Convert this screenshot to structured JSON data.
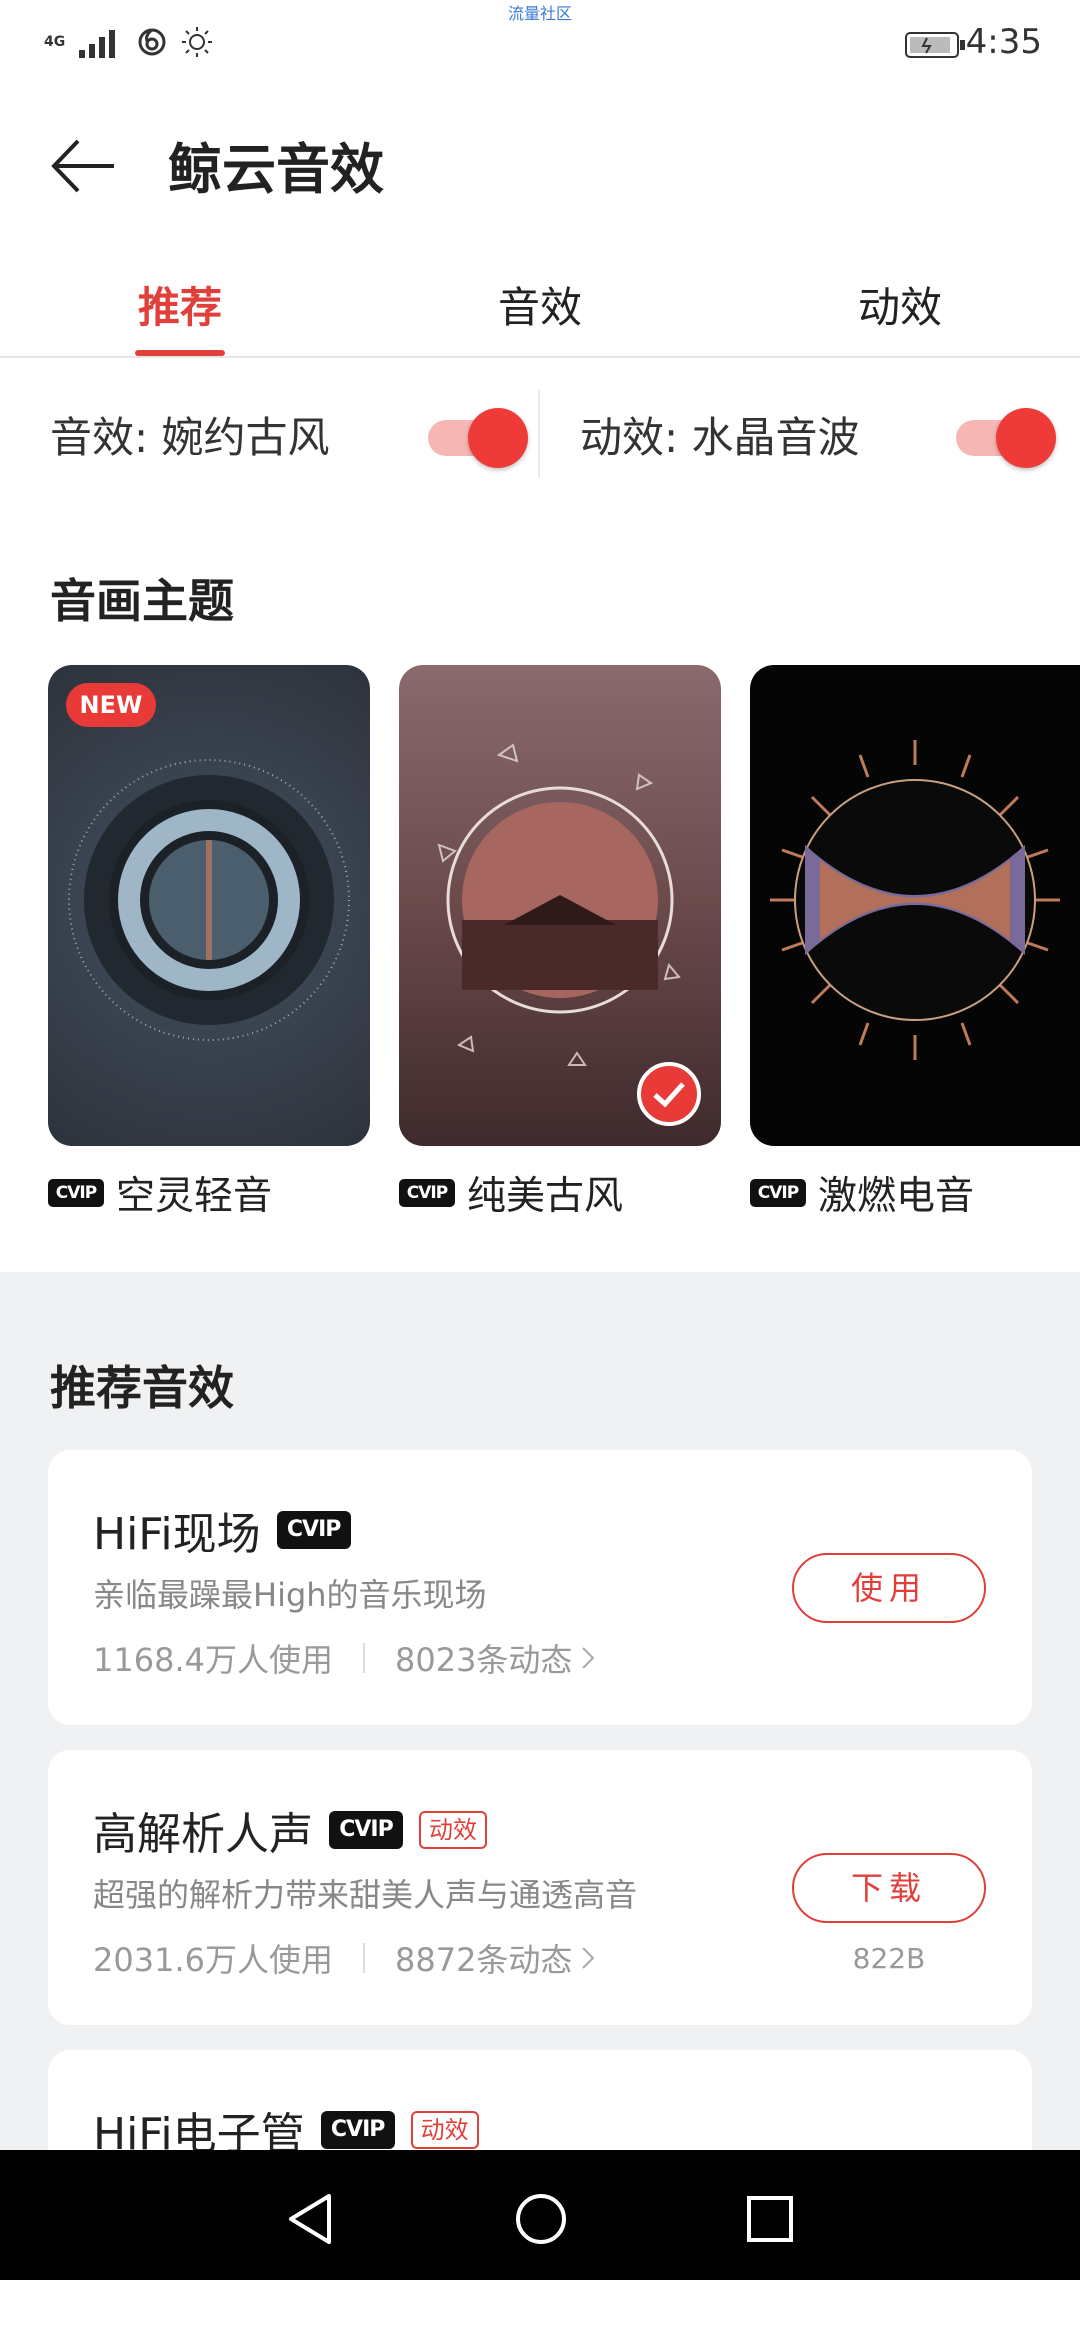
{
  "status_bar": {
    "carrier_text": "流量社区",
    "network": "4G",
    "time": "4:35"
  },
  "header": {
    "title": "鲸云音效"
  },
  "tabs": [
    {
      "label": "推荐",
      "active": true
    },
    {
      "label": "音效",
      "active": false
    },
    {
      "label": "动效",
      "active": false
    }
  ],
  "toggles": {
    "sound": {
      "label": "音效: 婉约古风",
      "on": true
    },
    "motion": {
      "label": "动效: 水晶音波",
      "on": true
    }
  },
  "themes_section": {
    "title": "音画主题",
    "items": [
      {
        "name": "空灵轻音",
        "vip": "CVIP",
        "badge": "NEW",
        "selected": false
      },
      {
        "name": "纯美古风",
        "vip": "CVIP",
        "badge": "",
        "selected": true
      },
      {
        "name": "激燃电音",
        "vip": "CVIP",
        "badge": "",
        "selected": false
      }
    ]
  },
  "effects_section": {
    "title": "推荐音效",
    "items": [
      {
        "name": "HiFi现场",
        "vip": "CVIP",
        "tag": "",
        "desc": "亲临最躁最High的音乐现场",
        "users": "1168.4万人使用",
        "posts": "8023条动态",
        "action": "使用",
        "size": ""
      },
      {
        "name": "高解析人声",
        "vip": "CVIP",
        "tag": "动效",
        "desc": "超强的解析力带来甜美人声与通透高音",
        "users": "2031.6万人使用",
        "posts": "8872条动态",
        "action": "下载",
        "size": "822B"
      },
      {
        "name": "HiFi电子管",
        "vip": "CVIP",
        "tag": "动效",
        "desc": "",
        "users": "",
        "posts": "",
        "action": "",
        "size": ""
      }
    ]
  },
  "colors": {
    "accent": "#e13f3a",
    "background_grey": "#eff1f3"
  },
  "icons": {
    "back": "arrow-left-icon",
    "nav_back": "triangle-back-icon",
    "nav_home": "circle-home-icon",
    "nav_recent": "square-recent-icon"
  }
}
